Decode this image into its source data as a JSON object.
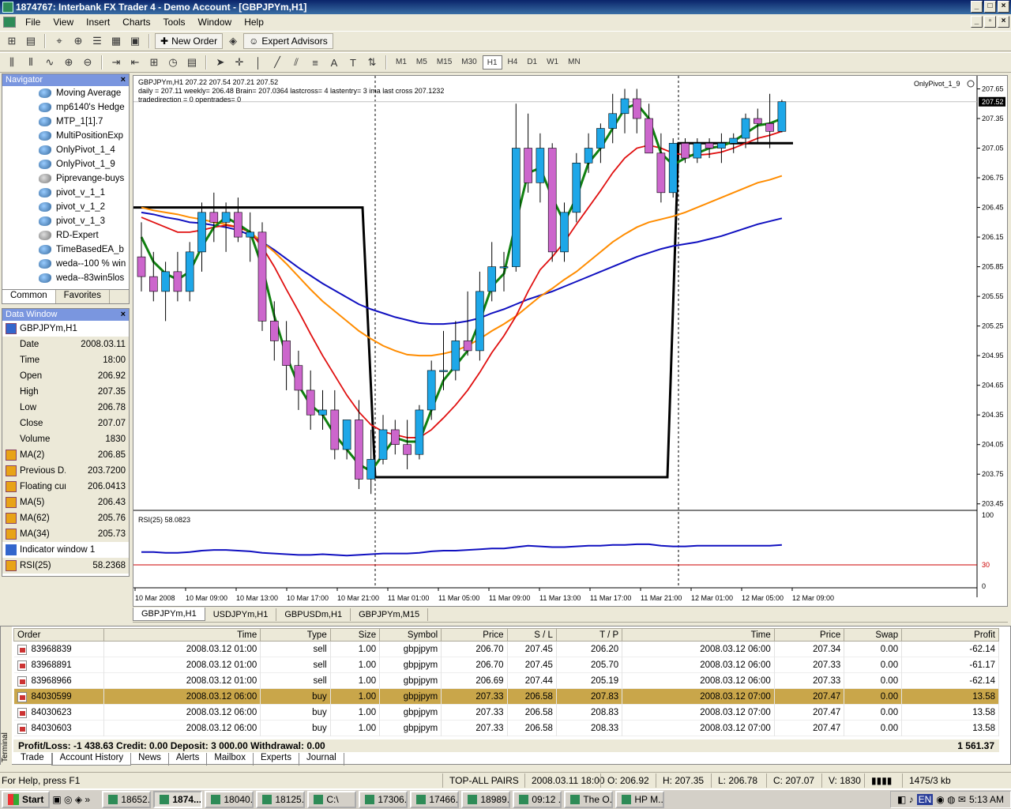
{
  "window": {
    "title": "1874767: Interbank FX Trader 4 - Demo Account - [GBPJPYm,H1]",
    "menu": [
      "File",
      "View",
      "Insert",
      "Charts",
      "Tools",
      "Window",
      "Help"
    ]
  },
  "toolbar1": {
    "new_order": "New Order",
    "expert_advisors": "Expert Advisors"
  },
  "timeframes": [
    "M1",
    "M5",
    "M15",
    "M30",
    "H1",
    "H4",
    "D1",
    "W1",
    "MN"
  ],
  "active_timeframe": "H1",
  "navigator": {
    "title": "Navigator",
    "items": [
      "Moving Average",
      "mp6140's Hedge",
      "MTP_1[1].7",
      "MultiPositionExp",
      "OnlyPivot_1_4",
      "OnlyPivot_1_9",
      "Piprevange-buys",
      "pivot_v_1_1",
      "pivot_v_1_2",
      "pivot_v_1_3",
      "RD-Expert",
      "TimeBasedEA_b",
      "weda--100 % win",
      "weda--83win5los"
    ],
    "tabs": [
      "Common",
      "Favorites"
    ]
  },
  "data_window": {
    "title": "Data Window",
    "symbol": "GBPJPYm,H1",
    "rows": [
      {
        "k": "Date",
        "v": "2008.03.11"
      },
      {
        "k": "Time",
        "v": "18:00"
      },
      {
        "k": "Open",
        "v": "206.92"
      },
      {
        "k": "High",
        "v": "207.35"
      },
      {
        "k": "Low",
        "v": "206.78"
      },
      {
        "k": "Close",
        "v": "207.07"
      },
      {
        "k": "Volume",
        "v": "1830"
      },
      {
        "k": "MA(2)",
        "v": "206.85",
        "icon": true
      },
      {
        "k": "Previous D...",
        "v": "203.7200",
        "icon": true
      },
      {
        "k": "Floating cur...",
        "v": "206.0413",
        "icon": true
      },
      {
        "k": "MA(5)",
        "v": "206.43",
        "icon": true
      },
      {
        "k": "MA(62)",
        "v": "205.76",
        "icon": true
      },
      {
        "k": "MA(34)",
        "v": "205.73",
        "icon": true
      }
    ],
    "indicator_window": "Indicator window 1",
    "rsi": {
      "k": "RSI(25)",
      "v": "58.2368"
    }
  },
  "chart": {
    "header1": "GBPJPYm,H1  207.22 207.54 207.21 207.52",
    "header2": "daily = 207.11 weekly= 206.48 Brain= 207.0364 lastcross= 4 lastentry= 3 ima last cross 207.1232",
    "header3": "tradedirection = 0 opentrades= 0",
    "ea_label": "OnlyPivot_1_9",
    "price_labels": [
      "207.65",
      "207.35",
      "207.05",
      "206.75",
      "206.45",
      "206.15",
      "205.85",
      "205.55",
      "205.25",
      "204.95",
      "204.65",
      "204.35",
      "204.05",
      "203.75",
      "203.45"
    ],
    "current_price": "207.52",
    "rsi_label": "RSI(25) 58.0823",
    "rsi_scale": [
      "100",
      "30",
      "0"
    ],
    "time_labels": [
      "10 Mar 2008",
      "10 Mar 09:00",
      "10 Mar 13:00",
      "10 Mar 17:00",
      "10 Mar 21:00",
      "11 Mar 01:00",
      "11 Mar 05:00",
      "11 Mar 09:00",
      "11 Mar 13:00",
      "11 Mar 17:00",
      "11 Mar 21:00",
      "12 Mar 01:00",
      "12 Mar 05:00",
      "12 Mar 09:00"
    ],
    "tabs": [
      "GBPJPYm,H1",
      "USDJPYm,H1",
      "GBPUSDm,H1",
      "GBPJPYm,M15"
    ]
  },
  "chart_data": {
    "type": "candlestick",
    "ylim": [
      203.4,
      207.75
    ],
    "candles": [
      [
        205.95,
        206.3,
        205.6,
        205.75
      ],
      [
        205.75,
        206.0,
        205.5,
        205.6
      ],
      [
        205.6,
        205.9,
        205.3,
        205.8
      ],
      [
        205.8,
        206.0,
        205.5,
        205.6
      ],
      [
        205.6,
        206.1,
        205.5,
        206.0
      ],
      [
        206.0,
        206.5,
        205.8,
        206.4
      ],
      [
        206.4,
        206.6,
        206.1,
        206.3
      ],
      [
        206.3,
        206.5,
        206.0,
        206.4
      ],
      [
        206.4,
        206.55,
        206.1,
        206.15
      ],
      [
        206.15,
        206.4,
        205.9,
        206.2
      ],
      [
        206.2,
        206.3,
        205.2,
        205.3
      ],
      [
        205.3,
        205.5,
        204.9,
        205.1
      ],
      [
        205.1,
        205.3,
        204.6,
        204.85
      ],
      [
        204.85,
        205.0,
        204.4,
        204.6
      ],
      [
        204.6,
        204.8,
        204.2,
        204.35
      ],
      [
        204.35,
        204.6,
        204.2,
        204.4
      ],
      [
        204.4,
        204.6,
        203.9,
        204.0
      ],
      [
        204.0,
        204.3,
        203.9,
        204.3
      ],
      [
        204.3,
        204.5,
        203.6,
        203.7
      ],
      [
        203.7,
        204.2,
        203.55,
        203.9
      ],
      [
        203.9,
        204.35,
        203.85,
        204.2
      ],
      [
        204.2,
        204.3,
        203.95,
        204.05
      ],
      [
        204.05,
        204.3,
        203.8,
        203.95
      ],
      [
        203.95,
        204.45,
        203.9,
        204.4
      ],
      [
        204.4,
        204.9,
        204.3,
        204.8
      ],
      [
        204.8,
        205.2,
        204.6,
        204.8
      ],
      [
        204.8,
        205.3,
        204.7,
        205.1
      ],
      [
        205.1,
        205.6,
        204.95,
        205.0
      ],
      [
        205.0,
        205.8,
        204.9,
        205.6
      ],
      [
        205.6,
        206.1,
        205.5,
        205.85
      ],
      [
        205.85,
        206.0,
        205.6,
        205.85
      ],
      [
        205.85,
        207.5,
        205.8,
        207.05
      ],
      [
        207.05,
        207.4,
        206.6,
        206.7
      ],
      [
        206.7,
        207.2,
        206.5,
        207.05
      ],
      [
        207.05,
        207.1,
        205.9,
        206.0
      ],
      [
        206.0,
        206.5,
        205.9,
        206.4
      ],
      [
        206.4,
        207.0,
        206.3,
        206.9
      ],
      [
        206.9,
        207.2,
        206.8,
        207.05
      ],
      [
        207.05,
        207.3,
        206.9,
        207.25
      ],
      [
        207.25,
        207.6,
        207.1,
        207.4
      ],
      [
        207.4,
        207.65,
        207.2,
        207.55
      ],
      [
        207.55,
        207.65,
        207.2,
        207.35
      ],
      [
        207.35,
        207.5,
        207.0,
        207.0
      ],
      [
        207.0,
        207.2,
        206.5,
        206.6
      ],
      [
        206.6,
        207.15,
        206.55,
        207.1
      ],
      [
        207.1,
        207.15,
        206.9,
        206.95
      ],
      [
        206.95,
        207.15,
        206.9,
        207.1
      ],
      [
        207.1,
        207.15,
        206.95,
        207.05
      ],
      [
        207.05,
        207.2,
        206.9,
        207.1
      ],
      [
        207.1,
        207.2,
        207.0,
        207.15
      ],
      [
        207.15,
        207.4,
        207.05,
        207.35
      ],
      [
        207.35,
        207.45,
        207.1,
        207.3
      ],
      [
        207.3,
        207.6,
        207.05,
        207.22
      ],
      [
        207.22,
        207.54,
        207.21,
        207.52
      ]
    ],
    "ma_blue": [
      206.4,
      206.38,
      206.35,
      206.33,
      206.3,
      206.29,
      206.27,
      206.25,
      206.22,
      206.17,
      206.1,
      206.02,
      205.93,
      205.84,
      205.76,
      205.68,
      205.61,
      205.54,
      205.47,
      205.42,
      205.38,
      205.34,
      205.31,
      205.28,
      205.27,
      205.27,
      205.28,
      205.3,
      205.33,
      205.38,
      205.42,
      205.47,
      205.52,
      205.56,
      205.6,
      205.65,
      205.7,
      205.75,
      205.8,
      205.85,
      205.9,
      205.95,
      205.99,
      206.03,
      206.06,
      206.08,
      206.1,
      206.13,
      206.16,
      206.2,
      206.24,
      206.28,
      206.31,
      206.34
    ],
    "ma_orange": [
      206.45,
      206.42,
      206.4,
      206.38,
      206.35,
      206.33,
      206.3,
      206.28,
      206.25,
      206.2,
      206.1,
      206.0,
      205.88,
      205.75,
      205.62,
      205.5,
      205.4,
      205.3,
      205.2,
      205.12,
      205.05,
      205.0,
      204.96,
      204.95,
      204.95,
      204.97,
      205.0,
      205.05,
      205.12,
      205.2,
      205.27,
      205.35,
      205.45,
      205.55,
      205.63,
      205.72,
      205.8,
      205.9,
      206.0,
      206.1,
      206.18,
      206.25,
      206.3,
      206.33,
      206.36,
      206.4,
      206.45,
      206.5,
      206.55,
      206.6,
      206.65,
      206.7,
      206.73,
      206.77
    ],
    "ma_red": [
      206.35,
      206.3,
      206.25,
      206.2,
      206.2,
      206.22,
      206.25,
      206.27,
      206.25,
      206.2,
      206.05,
      205.85,
      205.62,
      205.4,
      205.17,
      204.95,
      204.75,
      204.55,
      204.38,
      204.25,
      204.18,
      204.15,
      204.12,
      204.12,
      204.2,
      204.32,
      204.45,
      204.6,
      204.78,
      204.98,
      205.15,
      205.35,
      205.6,
      205.82,
      205.95,
      206.1,
      206.28,
      206.45,
      206.62,
      206.8,
      206.95,
      207.05,
      207.08,
      207.05,
      207.0,
      206.98,
      206.98,
      206.99,
      207.01,
      207.05,
      207.1,
      207.15,
      207.18,
      207.22
    ],
    "ma_green": [
      206.15,
      205.9,
      205.78,
      205.72,
      205.8,
      206.05,
      206.25,
      206.35,
      206.28,
      206.2,
      205.85,
      205.35,
      204.95,
      204.65,
      204.45,
      204.35,
      204.15,
      204.0,
      203.85,
      203.78,
      203.95,
      204.12,
      204.08,
      204.08,
      204.4,
      204.7,
      204.85,
      205.0,
      205.3,
      205.65,
      205.78,
      206.3,
      206.8,
      206.85,
      206.55,
      206.3,
      206.55,
      206.9,
      207.05,
      207.25,
      207.45,
      207.5,
      207.35,
      207.0,
      206.88,
      206.95,
      207.0,
      207.05,
      207.07,
      207.12,
      207.2,
      207.28,
      207.3,
      207.35
    ],
    "rsi": [
      48,
      48,
      47,
      47,
      48,
      50,
      51,
      51,
      50,
      49,
      47,
      46,
      45,
      44,
      44,
      45,
      44,
      43,
      44,
      45,
      46,
      46,
      46,
      47,
      49,
      50,
      50,
      51,
      52,
      53,
      53,
      55,
      57,
      56,
      55,
      55,
      56,
      57,
      57,
      58,
      58,
      59,
      59,
      57,
      56,
      56,
      57,
      57,
      57,
      57,
      57,
      57,
      57,
      58
    ],
    "rsi_level": 30
  },
  "terminal": {
    "side_label": "Terminal",
    "columns": [
      "Order",
      "Time",
      "Type",
      "Size",
      "Symbol",
      "Price",
      "S / L",
      "T / P",
      "Time",
      "Price",
      "Swap",
      "Profit"
    ],
    "rows": [
      [
        "83968839",
        "2008.03.12 01:00",
        "sell",
        "1.00",
        "gbpjpym",
        "206.70",
        "207.45",
        "206.20",
        "2008.03.12 06:00",
        "207.34",
        "0.00",
        "-62.14"
      ],
      [
        "83968891",
        "2008.03.12 01:00",
        "sell",
        "1.00",
        "gbpjpym",
        "206.70",
        "207.45",
        "205.70",
        "2008.03.12 06:00",
        "207.33",
        "0.00",
        "-61.17"
      ],
      [
        "83968966",
        "2008.03.12 01:00",
        "sell",
        "1.00",
        "gbpjpym",
        "206.69",
        "207.44",
        "205.19",
        "2008.03.12 06:00",
        "207.33",
        "0.00",
        "-62.14"
      ],
      [
        "84030599",
        "2008.03.12 06:00",
        "buy",
        "1.00",
        "gbpjpym",
        "207.33",
        "206.58",
        "207.83",
        "2008.03.12 07:00",
        "207.47",
        "0.00",
        "13.58"
      ],
      [
        "84030623",
        "2008.03.12 06:00",
        "buy",
        "1.00",
        "gbpjpym",
        "207.33",
        "206.58",
        "208.83",
        "2008.03.12 07:00",
        "207.47",
        "0.00",
        "13.58"
      ],
      [
        "84030603",
        "2008.03.12 06:00",
        "buy",
        "1.00",
        "gbpjpym",
        "207.33",
        "206.58",
        "208.33",
        "2008.03.12 07:00",
        "207.47",
        "0.00",
        "13.58"
      ]
    ],
    "highlight_row": 3,
    "summary": "Profit/Loss: -1 438.63  Credit: 0.00  Deposit: 3 000.00  Withdrawal: 0.00",
    "total": "1 561.37",
    "tabs": [
      "Trade",
      "Account History",
      "News",
      "Alerts",
      "Mailbox",
      "Experts",
      "Journal"
    ],
    "active_tab": "Account History"
  },
  "statusbar": {
    "help": "For Help, press F1",
    "profile": "TOP-ALL PAIRS",
    "datetime": "2008.03.11 18:00",
    "o": "O: 206.92",
    "h": "H: 207.35",
    "l": "L: 206.78",
    "c": "C: 207.07",
    "v": "V: 1830",
    "traffic": "1475/3 kb"
  },
  "taskbar": {
    "start": "Start",
    "tasks": [
      "18652...",
      "1874...",
      "18040...",
      "18125...",
      "C:\\",
      "17306...",
      "17466...",
      "18989...",
      "09:12 ...",
      "The O...",
      "HP M..."
    ],
    "active_task": 1,
    "lang": "EN",
    "clock": "5:13 AM"
  },
  "colors": {
    "bull": "#1ea7e8",
    "bear": "#cc66cc",
    "ma_blue": "#1010c0",
    "ma_orange": "#ff8c00",
    "ma_red": "#e01010",
    "ma_green": "#108010",
    "highlight": "#c9a64a"
  }
}
